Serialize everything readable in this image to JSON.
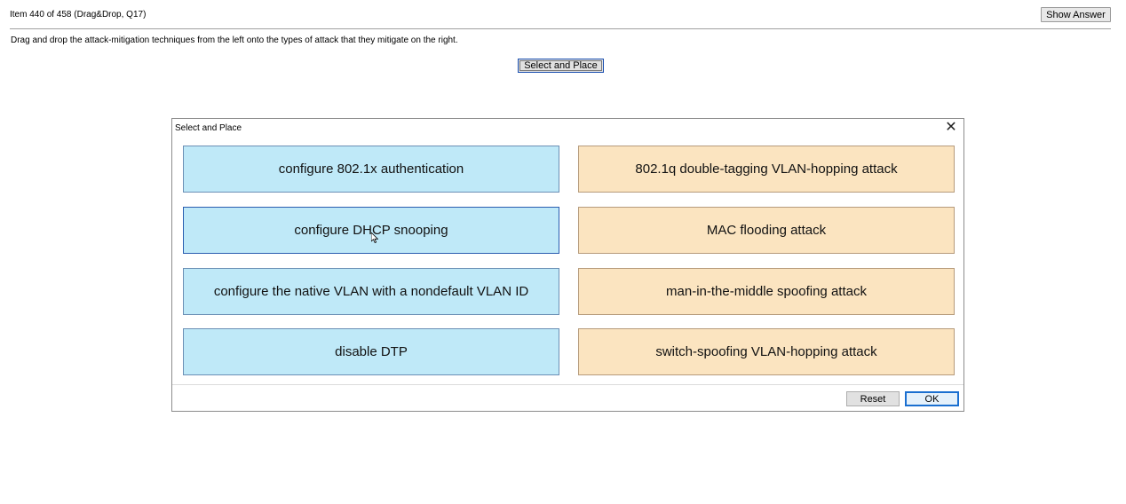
{
  "header": {
    "item_info": "Item 440 of 458  (Drag&Drop, Q17)",
    "show_answer_label": "Show Answer"
  },
  "instruction": "Drag and drop the attack-mitigation techniques from the left onto the types of attack that they mitigate on the right.",
  "select_place_label": "Select and Place",
  "dialog": {
    "title": "Select and Place",
    "close_glyph": "✕",
    "left_items": [
      "configure 802.1x authentication",
      "configure DHCP snooping",
      "configure the native VLAN with a nondefault VLAN ID",
      "disable DTP"
    ],
    "right_items": [
      "802.1q double-tagging VLAN-hopping attack",
      "MAC flooding attack",
      "man-in-the-middle spoofing attack",
      "switch-spoofing VLAN-hopping attack"
    ],
    "reset_label": "Reset",
    "ok_label": "OK"
  },
  "colors": {
    "left_tile": "#bfe9f8",
    "right_tile": "#fbe4c0",
    "ok_border": "#1a6fd0"
  }
}
